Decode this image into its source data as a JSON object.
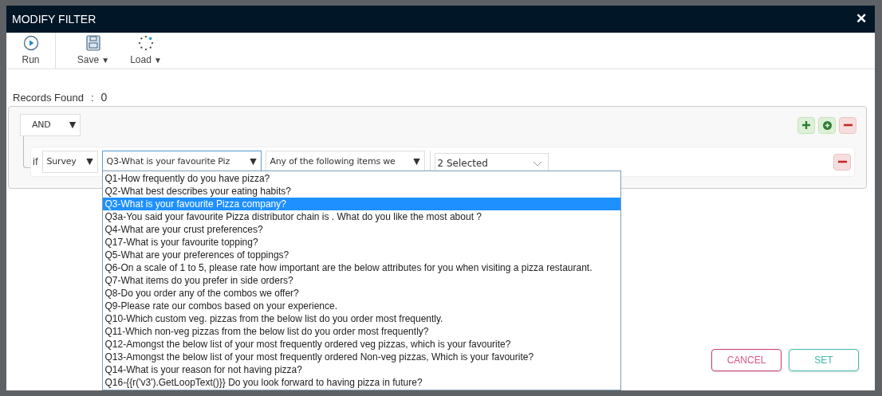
{
  "window": {
    "title": "MODIFY FILTER",
    "close": "✕"
  },
  "toolbar": [
    {
      "label": "Run",
      "kind": "run"
    },
    {
      "label": "Save",
      "kind": "save",
      "caret": "▼"
    },
    {
      "label": "Load",
      "kind": "load",
      "caret": "▼"
    }
  ],
  "records": {
    "label": "Records Found",
    "separator": ":",
    "count": "0"
  },
  "filter": {
    "operator": {
      "value": "AND",
      "caret": "▼"
    },
    "group_actions": [
      {
        "kind": "add"
      },
      {
        "kind": "add-group"
      },
      {
        "kind": "remove"
      }
    ],
    "rules": [
      {
        "prefix": "if",
        "source": {
          "value": "Survey",
          "caret": "▼"
        },
        "question": {
          "value": "Q3-What is your favourite Piz",
          "caret": "▼",
          "expanded": true,
          "options": [
            {
              "label": "Q1-How frequently do you have pizza?",
              "selected": false
            },
            {
              "label": "Q2-What best describes your eating habits?",
              "selected": false
            },
            {
              "label": "Q3-What is your favourite Pizza company?",
              "selected": true
            },
            {
              "label": "Q3a-You said your favourite Pizza distributor chain is . What do you like the most about ?",
              "selected": false
            },
            {
              "label": "Q4-What are your crust preferences?",
              "selected": false
            },
            {
              "label": "Q17-What is your favourite topping?",
              "selected": false
            },
            {
              "label": "Q5-What are your preferences of toppings?",
              "selected": false
            },
            {
              "label": "Q6-On a scale of 1 to 5, please rate how important are the below attributes for you when visiting a pizza restaurant.",
              "selected": false
            },
            {
              "label": "Q7-What items do you prefer in side orders?",
              "selected": false
            },
            {
              "label": "Q8-Do you order any of the combos we offer?",
              "selected": false
            },
            {
              "label": "Q9-Please rate our combos based on your experience.",
              "selected": false
            },
            {
              "label": "Q10-Which custom veg. pizzas from the below list do you order most frequently.",
              "selected": false
            },
            {
              "label": "Q11-Which non-veg pizzas from the below list do you order most frequently?",
              "selected": false
            },
            {
              "label": "Q12-Amongst the below list of your most frequently ordered veg pizzas, which is your favourite?",
              "selected": false
            },
            {
              "label": "Q13-Amongst the below list of your most frequently ordered Non-veg pizzas, Which is your favourite?",
              "selected": false
            },
            {
              "label": "Q14-What is your reason for not having pizza?",
              "selected": false
            },
            {
              "label": "Q16-{{r('v3').GetLoopText()}} Do you look forward to having pizza in future?",
              "selected": false
            }
          ]
        },
        "condition": {
          "value": "Any of the following items we",
          "caret": "▼"
        },
        "answer": {
          "value": "2 Selected"
        }
      }
    ]
  },
  "buttons": [
    {
      "label": "CANCEL",
      "kind": "cancel"
    },
    {
      "label": "SET",
      "kind": "confirm"
    }
  ]
}
